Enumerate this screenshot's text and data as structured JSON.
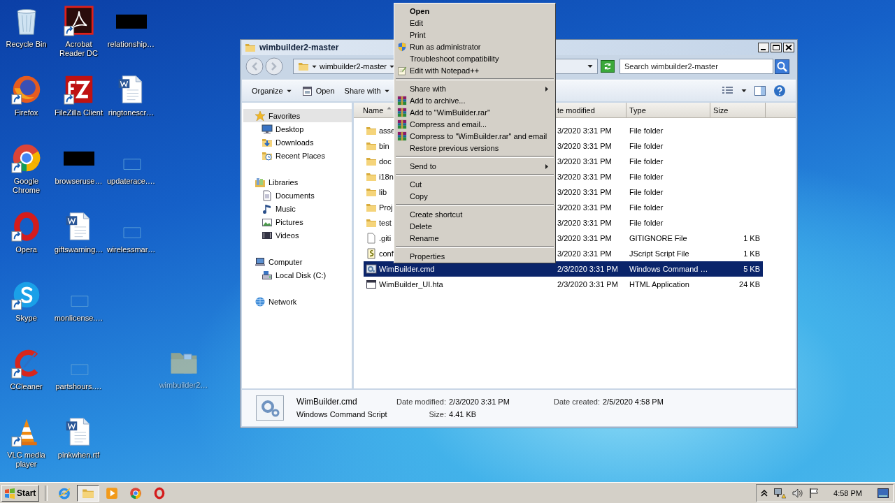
{
  "desktop": {
    "icons": [
      {
        "label": "Recycle Bin",
        "kind": "recycle",
        "shortcut": false,
        "dragging": false
      },
      {
        "label": "Firefox",
        "kind": "firefox",
        "shortcut": true,
        "dragging": false
      },
      {
        "label": "Google Chrome",
        "kind": "chrome",
        "shortcut": true,
        "dragging": false
      },
      {
        "label": "Opera",
        "kind": "opera",
        "shortcut": true,
        "dragging": false
      },
      {
        "label": "Skype",
        "kind": "skype",
        "shortcut": true,
        "dragging": false
      },
      {
        "label": "CCleaner",
        "kind": "ccleaner",
        "shortcut": true,
        "dragging": false
      },
      {
        "label": "VLC media player",
        "kind": "vlc",
        "shortcut": true,
        "dragging": false
      },
      {
        "label": "Acrobat Reader DC",
        "kind": "acrobat",
        "shortcut": true,
        "dragging": false
      },
      {
        "label": "FileZilla Client",
        "kind": "filezilla",
        "shortcut": true,
        "dragging": false
      },
      {
        "label": "browseruse…",
        "kind": "redacted",
        "shortcut": false,
        "dragging": false
      },
      {
        "label": "giftswarning…",
        "kind": "word",
        "shortcut": false,
        "dragging": false
      },
      {
        "label": "monlicense.…",
        "kind": "blank",
        "shortcut": false,
        "dragging": false
      },
      {
        "label": "partshours.…",
        "kind": "blank",
        "shortcut": false,
        "dragging": false
      },
      {
        "label": "pinkwhen.rtf",
        "kind": "word",
        "shortcut": false,
        "dragging": false
      },
      {
        "label": "relationship…",
        "kind": "redacted",
        "shortcut": false,
        "dragging": false
      },
      {
        "label": "ringtonescr…",
        "kind": "word",
        "shortcut": false,
        "dragging": false
      },
      {
        "label": "updaterace.…",
        "kind": "blank",
        "shortcut": false,
        "dragging": false
      },
      {
        "label": "wirelessmar…",
        "kind": "blank",
        "shortcut": false,
        "dragging": false
      },
      {
        "label": "wimbuilder2…",
        "kind": "folder",
        "shortcut": false,
        "dragging": true
      }
    ]
  },
  "explorer": {
    "title": "wimbuilder2-master",
    "address": {
      "segments": [
        "wimbuilder2-master"
      ]
    },
    "search": {
      "placeholder": "Search wimbuilder2-master"
    },
    "toolbar": [
      {
        "label": "Organize",
        "kind": "none",
        "dropdown": true
      },
      {
        "label": "Open",
        "kind": "open",
        "dropdown": false
      },
      {
        "label": "Share with",
        "kind": "none",
        "dropdown": true
      }
    ],
    "navigation": [
      {
        "label": "Favorites",
        "kind": "star",
        "selected": true,
        "children": [
          {
            "label": "Desktop",
            "kind": "desktop",
            "selected": false
          },
          {
            "label": "Downloads",
            "kind": "downloads",
            "selected": false
          },
          {
            "label": "Recent Places",
            "kind": "recent",
            "selected": false
          }
        ]
      },
      {
        "label": "Libraries",
        "kind": "libraries",
        "selected": false,
        "children": [
          {
            "label": "Documents",
            "kind": "documents",
            "selected": false
          },
          {
            "label": "Music",
            "kind": "music",
            "selected": false
          },
          {
            "label": "Pictures",
            "kind": "pictures",
            "selected": false
          },
          {
            "label": "Videos",
            "kind": "videos",
            "selected": false
          }
        ]
      },
      {
        "label": "Computer",
        "kind": "computer",
        "selected": false,
        "children": [
          {
            "label": "Local Disk (C:)",
            "kind": "disk",
            "selected": false
          }
        ]
      },
      {
        "label": "Network",
        "kind": "network",
        "selected": false
      }
    ],
    "columns": [
      {
        "label": "Name",
        "sorted": true
      },
      {
        "label": "te modified",
        "sorted": false
      },
      {
        "label": "Type",
        "sorted": false
      },
      {
        "label": "Size",
        "sorted": false
      }
    ],
    "files": [
      {
        "name": "asse",
        "kind": "folder",
        "modified": "3/2020 3:31 PM",
        "type": "File folder",
        "selected": false
      },
      {
        "name": "bin",
        "kind": "folder",
        "modified": "3/2020 3:31 PM",
        "type": "File folder",
        "selected": false
      },
      {
        "name": "doc",
        "kind": "folder",
        "modified": "3/2020 3:31 PM",
        "type": "File folder",
        "selected": false
      },
      {
        "name": "i18n",
        "kind": "folder",
        "modified": "3/2020 3:31 PM",
        "type": "File folder",
        "selected": false
      },
      {
        "name": "lib",
        "kind": "folder",
        "modified": "3/2020 3:31 PM",
        "type": "File folder",
        "selected": false
      },
      {
        "name": "Proj",
        "kind": "folder",
        "modified": "3/2020 3:31 PM",
        "type": "File folder",
        "selected": false
      },
      {
        "name": "test",
        "kind": "folder",
        "modified": "3/2020 3:31 PM",
        "type": "File folder",
        "selected": false
      },
      {
        "name": ".giti",
        "kind": "file",
        "modified": "3/2020 3:31 PM",
        "type": "GITIGNORE File",
        "size": "1 KB",
        "selected": false
      },
      {
        "name": "conf",
        "kind": "script",
        "modified": "3/2020 3:31 PM",
        "type": "JScript Script File",
        "size": "1 KB",
        "selected": false
      },
      {
        "name": "WimBuilder.cmd",
        "kind": "cmd",
        "modified": "2/3/2020 3:31 PM",
        "type": "Windows Command …",
        "size": "5 KB",
        "selected": true
      },
      {
        "name": "WimBuilder_UI.hta",
        "kind": "app",
        "modified": "2/3/2020 3:31 PM",
        "type": "HTML Application",
        "size": "24 KB",
        "selected": false
      }
    ],
    "details": {
      "name": "WimBuilder.cmd",
      "type": "Windows Command Script",
      "modified_label": "Date modified:",
      "modified": "2/3/2020 3:31 PM",
      "size_label": "Size:",
      "size": "4.41 KB",
      "created_label": "Date created:",
      "created": "2/5/2020 4:58 PM"
    }
  },
  "context_menu": {
    "groups": [
      [
        {
          "label": "Open",
          "kind": "none",
          "default": true,
          "submenu": false
        },
        {
          "label": "Edit",
          "kind": "none",
          "default": false,
          "submenu": false
        },
        {
          "label": "Print",
          "kind": "none",
          "default": false,
          "submenu": false
        },
        {
          "label": "Run as administrator",
          "kind": "shield",
          "default": false,
          "submenu": false
        },
        {
          "label": "Troubleshoot compatibility",
          "kind": "none",
          "default": false,
          "submenu": false
        },
        {
          "label": "Edit with Notepad++",
          "kind": "notepad",
          "default": false,
          "submenu": false
        }
      ],
      [
        {
          "label": "Share with",
          "kind": "none",
          "default": false,
          "submenu": true
        },
        {
          "label": "Add to archive...",
          "kind": "archive",
          "default": false,
          "submenu": false
        },
        {
          "label": "Add to \"WimBuilder.rar\"",
          "kind": "archive",
          "default": false,
          "submenu": false
        },
        {
          "label": "Compress and email...",
          "kind": "archive",
          "default": false,
          "submenu": false
        },
        {
          "label": "Compress to \"WimBuilder.rar\" and email",
          "kind": "archive",
          "default": false,
          "submenu": false
        },
        {
          "label": "Restore previous versions",
          "kind": "none",
          "default": false,
          "submenu": false
        }
      ],
      [
        {
          "label": "Send to",
          "kind": "none",
          "default": false,
          "submenu": true
        }
      ],
      [
        {
          "label": "Cut",
          "kind": "none",
          "default": false,
          "submenu": false
        },
        {
          "label": "Copy",
          "kind": "none",
          "default": false,
          "submenu": false
        }
      ],
      [
        {
          "label": "Create shortcut",
          "kind": "none",
          "default": false,
          "submenu": false
        },
        {
          "label": "Delete",
          "kind": "none",
          "default": false,
          "submenu": false
        },
        {
          "label": "Rename",
          "kind": "none",
          "default": false,
          "submenu": false
        }
      ],
      [
        {
          "label": "Properties",
          "kind": "none",
          "default": false,
          "submenu": false
        }
      ]
    ]
  },
  "taskbar": {
    "start": "Start",
    "apps": [
      {
        "kind": "ie",
        "selected": false
      },
      {
        "kind": "explorer",
        "selected": true
      },
      {
        "kind": "media",
        "selected": false
      },
      {
        "kind": "chrome",
        "selected": false
      },
      {
        "kind": "opera",
        "selected": false
      }
    ],
    "clock": "4:58 PM"
  }
}
